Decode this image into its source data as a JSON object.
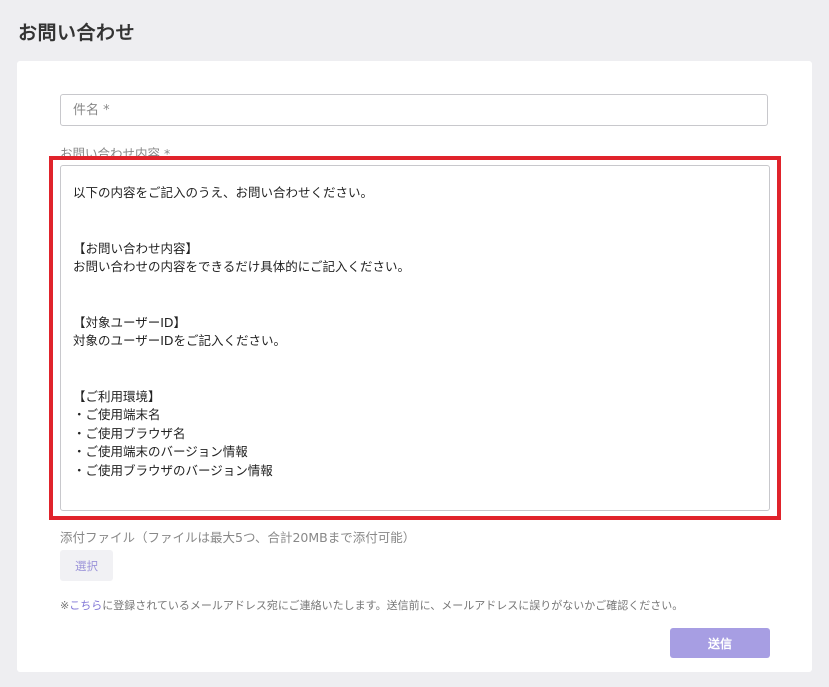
{
  "page": {
    "title": "お問い合わせ"
  },
  "form": {
    "subject_placeholder": "件名 *",
    "content_label": "お問い合わせ内容 *",
    "content_lines": [
      "以下の内容をご記入のうえ、お問い合わせください。",
      "",
      "",
      "【お問い合わせ内容】",
      "お問い合わせの内容をできるだけ具体的にご記入ください。",
      "",
      "",
      "【対象ユーザーID】",
      "対象のユーザーIDをご記入ください。",
      "",
      "",
      "【ご利用環境】",
      "・ご使用端末名",
      "・ご使用ブラウザ名",
      "・ご使用端末のバージョン情報",
      "・ご使用ブラウザのバージョン情報"
    ],
    "attachment_label": "添付ファイル（ファイルは最大5つ、合計20MBまで添付可能）",
    "select_label": "選択",
    "notice_prefix": "※",
    "notice_link": "こちら",
    "notice_suffix": "に登録されているメールアドレス宛にご連絡いたします。送信前に、メールアドレスに誤りがないかご確認ください。",
    "submit_label": "送信"
  },
  "colors": {
    "accent": "#a79ee3",
    "link": "#7f74d6",
    "highlight": "#e0232b"
  }
}
